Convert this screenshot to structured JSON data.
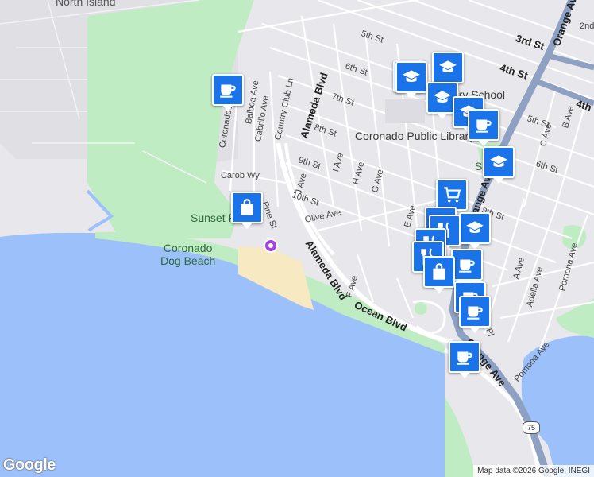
{
  "map": {
    "labels": {
      "north_island": "North Island",
      "st_5th": "5th St",
      "st_3rd": "3rd St",
      "st_4th": "4th St",
      "st_6th": "6th St",
      "st_7th": "7th St",
      "st_8th": "8th St",
      "st_9th": "9th St",
      "st_10th": "10th St",
      "st_4th_e": "4th",
      "st_5th_e": "5th St",
      "st_6th_e": "6th St",
      "st_2nd": "2nd S",
      "st_8th_e": "8th St",
      "st_orange_ave": "Orange Ave",
      "st_orange_ave_2": "Orange Ave",
      "st_orange_ave_3": "Orange Ave",
      "st_alameda_n": "Alameda Blvd",
      "st_alameda_s": "Alameda Blvd",
      "st_ocean": "Ocean Blvd",
      "st_olive": "Olive Ave",
      "st_carob": "Carob Wy",
      "st_pine": "Pine St",
      "st_coronado": "Coronado Ave",
      "st_balboa": "Balboa Ave",
      "st_cabrillo": "Cabrillo Ave",
      "st_country_club": "Country Club Ln",
      "st_j_ave": "J Ave",
      "st_i_ave": "I Ave",
      "st_h_ave": "H Ave",
      "st_g_ave": "G Ave",
      "st_f_ave": "F Ave",
      "st_e_ave": "E Ave",
      "st_c_ave": "C Ave",
      "st_b_ave": "B Ave",
      "st_a_ave": "A Ave",
      "st_adella": "Adella Ave",
      "st_pomona": "Pomona Ave",
      "st_pomona_2": "Pomona Ave",
      "st_nez": "nez Pl",
      "school": "tary School",
      "library": "Coronado Public Library",
      "park": "S      ls Pk",
      "sunset_park": "Sunset P",
      "dog_beach": "Coronado\nDog Beach",
      "highway_75": "75"
    },
    "colors": {
      "water": "#9cc0f9",
      "land": "#e8e8ec",
      "park": "#c0ecc3",
      "sand": "#f7e9c2",
      "marker": "#1a73e8",
      "highway": "#8ea1c2"
    },
    "markers": [
      {
        "type": "coffee-icon",
        "name": "coffee-marker-1"
      },
      {
        "type": "shopping-bag-icon",
        "name": "shopping-marker-1"
      },
      {
        "type": "graduation-cap-icon",
        "name": "school-marker-1"
      },
      {
        "type": "graduation-cap-icon",
        "name": "school-marker-2"
      },
      {
        "type": "graduation-cap-icon",
        "name": "school-marker-3"
      },
      {
        "type": "graduation-cap-icon",
        "name": "school-marker-4"
      },
      {
        "type": "coffee-icon",
        "name": "coffee-marker-2"
      },
      {
        "type": "graduation-cap-icon",
        "name": "school-marker-5"
      },
      {
        "type": "shopping-cart-icon",
        "name": "grocery-marker-1"
      },
      {
        "type": "graduation-cap-icon",
        "name": "school-marker-6"
      },
      {
        "type": "restaurant-icon",
        "name": "restaurant-marker-1"
      },
      {
        "type": "restaurant-icon",
        "name": "restaurant-marker-2"
      },
      {
        "type": "coffee-icon",
        "name": "coffee-marker-3"
      },
      {
        "type": "shopping-bag-icon",
        "name": "shopping-marker-2"
      },
      {
        "type": "coffee-icon",
        "name": "coffee-marker-4"
      },
      {
        "type": "coffee-icon",
        "name": "coffee-marker-5"
      },
      {
        "type": "coffee-icon",
        "name": "coffee-marker-6"
      }
    ]
  },
  "footer": {
    "google_logo": "Google",
    "attribution": "Map data ©2026 Google, INEGI"
  }
}
